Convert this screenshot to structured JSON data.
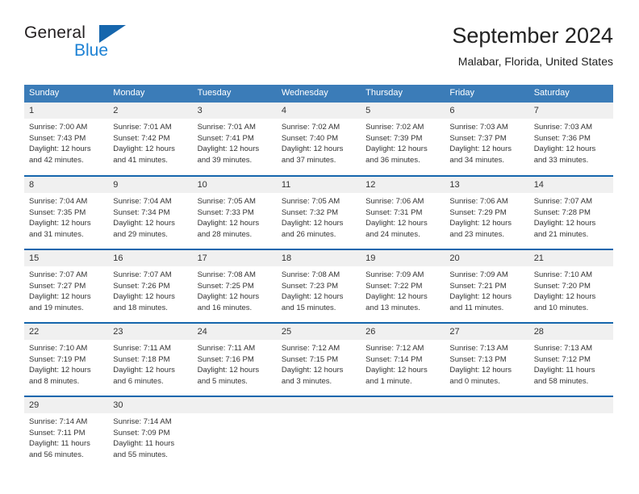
{
  "brand": {
    "line1": "General",
    "line2": "Blue",
    "triangle_color": "#1666ad",
    "blue_color": "#1c81d4"
  },
  "header": {
    "title": "September 2024",
    "subtitle": "Malabar, Florida, United States"
  },
  "theme": {
    "header_row_bg": "#3b7cb8",
    "row_divider": "#1666ad",
    "daynum_bg": "#f0f0f0",
    "text": "#333333"
  },
  "weekdays": [
    "Sunday",
    "Monday",
    "Tuesday",
    "Wednesday",
    "Thursday",
    "Friday",
    "Saturday"
  ],
  "labels": {
    "sunrise": "Sunrise:",
    "sunset": "Sunset:",
    "daylight": "Daylight:"
  },
  "weeks": [
    [
      {
        "day": "1",
        "sunrise": "Sunrise: 7:00 AM",
        "sunset": "Sunset: 7:43 PM",
        "daylight1": "Daylight: 12 hours",
        "daylight2": "and 42 minutes."
      },
      {
        "day": "2",
        "sunrise": "Sunrise: 7:01 AM",
        "sunset": "Sunset: 7:42 PM",
        "daylight1": "Daylight: 12 hours",
        "daylight2": "and 41 minutes."
      },
      {
        "day": "3",
        "sunrise": "Sunrise: 7:01 AM",
        "sunset": "Sunset: 7:41 PM",
        "daylight1": "Daylight: 12 hours",
        "daylight2": "and 39 minutes."
      },
      {
        "day": "4",
        "sunrise": "Sunrise: 7:02 AM",
        "sunset": "Sunset: 7:40 PM",
        "daylight1": "Daylight: 12 hours",
        "daylight2": "and 37 minutes."
      },
      {
        "day": "5",
        "sunrise": "Sunrise: 7:02 AM",
        "sunset": "Sunset: 7:39 PM",
        "daylight1": "Daylight: 12 hours",
        "daylight2": "and 36 minutes."
      },
      {
        "day": "6",
        "sunrise": "Sunrise: 7:03 AM",
        "sunset": "Sunset: 7:37 PM",
        "daylight1": "Daylight: 12 hours",
        "daylight2": "and 34 minutes."
      },
      {
        "day": "7",
        "sunrise": "Sunrise: 7:03 AM",
        "sunset": "Sunset: 7:36 PM",
        "daylight1": "Daylight: 12 hours",
        "daylight2": "and 33 minutes."
      }
    ],
    [
      {
        "day": "8",
        "sunrise": "Sunrise: 7:04 AM",
        "sunset": "Sunset: 7:35 PM",
        "daylight1": "Daylight: 12 hours",
        "daylight2": "and 31 minutes."
      },
      {
        "day": "9",
        "sunrise": "Sunrise: 7:04 AM",
        "sunset": "Sunset: 7:34 PM",
        "daylight1": "Daylight: 12 hours",
        "daylight2": "and 29 minutes."
      },
      {
        "day": "10",
        "sunrise": "Sunrise: 7:05 AM",
        "sunset": "Sunset: 7:33 PM",
        "daylight1": "Daylight: 12 hours",
        "daylight2": "and 28 minutes."
      },
      {
        "day": "11",
        "sunrise": "Sunrise: 7:05 AM",
        "sunset": "Sunset: 7:32 PM",
        "daylight1": "Daylight: 12 hours",
        "daylight2": "and 26 minutes."
      },
      {
        "day": "12",
        "sunrise": "Sunrise: 7:06 AM",
        "sunset": "Sunset: 7:31 PM",
        "daylight1": "Daylight: 12 hours",
        "daylight2": "and 24 minutes."
      },
      {
        "day": "13",
        "sunrise": "Sunrise: 7:06 AM",
        "sunset": "Sunset: 7:29 PM",
        "daylight1": "Daylight: 12 hours",
        "daylight2": "and 23 minutes."
      },
      {
        "day": "14",
        "sunrise": "Sunrise: 7:07 AM",
        "sunset": "Sunset: 7:28 PM",
        "daylight1": "Daylight: 12 hours",
        "daylight2": "and 21 minutes."
      }
    ],
    [
      {
        "day": "15",
        "sunrise": "Sunrise: 7:07 AM",
        "sunset": "Sunset: 7:27 PM",
        "daylight1": "Daylight: 12 hours",
        "daylight2": "and 19 minutes."
      },
      {
        "day": "16",
        "sunrise": "Sunrise: 7:07 AM",
        "sunset": "Sunset: 7:26 PM",
        "daylight1": "Daylight: 12 hours",
        "daylight2": "and 18 minutes."
      },
      {
        "day": "17",
        "sunrise": "Sunrise: 7:08 AM",
        "sunset": "Sunset: 7:25 PM",
        "daylight1": "Daylight: 12 hours",
        "daylight2": "and 16 minutes."
      },
      {
        "day": "18",
        "sunrise": "Sunrise: 7:08 AM",
        "sunset": "Sunset: 7:23 PM",
        "daylight1": "Daylight: 12 hours",
        "daylight2": "and 15 minutes."
      },
      {
        "day": "19",
        "sunrise": "Sunrise: 7:09 AM",
        "sunset": "Sunset: 7:22 PM",
        "daylight1": "Daylight: 12 hours",
        "daylight2": "and 13 minutes."
      },
      {
        "day": "20",
        "sunrise": "Sunrise: 7:09 AM",
        "sunset": "Sunset: 7:21 PM",
        "daylight1": "Daylight: 12 hours",
        "daylight2": "and 11 minutes."
      },
      {
        "day": "21",
        "sunrise": "Sunrise: 7:10 AM",
        "sunset": "Sunset: 7:20 PM",
        "daylight1": "Daylight: 12 hours",
        "daylight2": "and 10 minutes."
      }
    ],
    [
      {
        "day": "22",
        "sunrise": "Sunrise: 7:10 AM",
        "sunset": "Sunset: 7:19 PM",
        "daylight1": "Daylight: 12 hours",
        "daylight2": "and 8 minutes."
      },
      {
        "day": "23",
        "sunrise": "Sunrise: 7:11 AM",
        "sunset": "Sunset: 7:18 PM",
        "daylight1": "Daylight: 12 hours",
        "daylight2": "and 6 minutes."
      },
      {
        "day": "24",
        "sunrise": "Sunrise: 7:11 AM",
        "sunset": "Sunset: 7:16 PM",
        "daylight1": "Daylight: 12 hours",
        "daylight2": "and 5 minutes."
      },
      {
        "day": "25",
        "sunrise": "Sunrise: 7:12 AM",
        "sunset": "Sunset: 7:15 PM",
        "daylight1": "Daylight: 12 hours",
        "daylight2": "and 3 minutes."
      },
      {
        "day": "26",
        "sunrise": "Sunrise: 7:12 AM",
        "sunset": "Sunset: 7:14 PM",
        "daylight1": "Daylight: 12 hours",
        "daylight2": "and 1 minute."
      },
      {
        "day": "27",
        "sunrise": "Sunrise: 7:13 AM",
        "sunset": "Sunset: 7:13 PM",
        "daylight1": "Daylight: 12 hours",
        "daylight2": "and 0 minutes."
      },
      {
        "day": "28",
        "sunrise": "Sunrise: 7:13 AM",
        "sunset": "Sunset: 7:12 PM",
        "daylight1": "Daylight: 11 hours",
        "daylight2": "and 58 minutes."
      }
    ],
    [
      {
        "day": "29",
        "sunrise": "Sunrise: 7:14 AM",
        "sunset": "Sunset: 7:11 PM",
        "daylight1": "Daylight: 11 hours",
        "daylight2": "and 56 minutes."
      },
      {
        "day": "30",
        "sunrise": "Sunrise: 7:14 AM",
        "sunset": "Sunset: 7:09 PM",
        "daylight1": "Daylight: 11 hours",
        "daylight2": "and 55 minutes."
      },
      {
        "day": "",
        "sunrise": "",
        "sunset": "",
        "daylight1": "",
        "daylight2": "",
        "empty": true
      },
      {
        "day": "",
        "sunrise": "",
        "sunset": "",
        "daylight1": "",
        "daylight2": "",
        "empty": true
      },
      {
        "day": "",
        "sunrise": "",
        "sunset": "",
        "daylight1": "",
        "daylight2": "",
        "empty": true
      },
      {
        "day": "",
        "sunrise": "",
        "sunset": "",
        "daylight1": "",
        "daylight2": "",
        "empty": true
      },
      {
        "day": "",
        "sunrise": "",
        "sunset": "",
        "daylight1": "",
        "daylight2": "",
        "empty": true
      }
    ]
  ]
}
